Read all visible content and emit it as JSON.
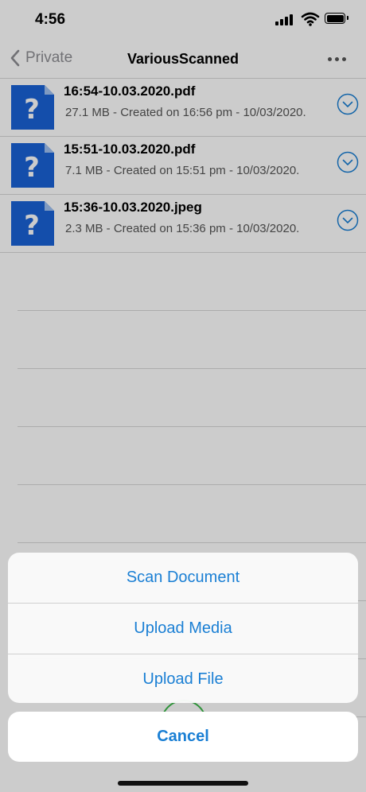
{
  "status_bar": {
    "time": "4:56"
  },
  "nav": {
    "back_label": "Private",
    "title": "VariousScanned"
  },
  "files": [
    {
      "name": "16:54-10.03.2020.pdf",
      "meta": "27.1 MB - Created on 16:56 pm - 10/03/2020."
    },
    {
      "name": "15:51-10.03.2020.pdf",
      "meta": "7.1 MB - Created on 15:51 pm - 10/03/2020."
    },
    {
      "name": "15:36-10.03.2020.jpeg",
      "meta": "2.3 MB - Created on 15:36 pm - 10/03/2020."
    }
  ],
  "action_sheet": {
    "options": [
      "Scan Document",
      "Upload Media",
      "Upload File"
    ],
    "cancel_label": "Cancel"
  },
  "colors": {
    "accent": "#1a7fd4",
    "file_icon": "#1a62d6",
    "fab_ring": "#3cb84a"
  },
  "icons": {
    "file": "unknown-file-icon",
    "row_action": "chevron-down-circle-icon",
    "back": "chevron-left-icon",
    "more": "ellipsis-icon"
  }
}
